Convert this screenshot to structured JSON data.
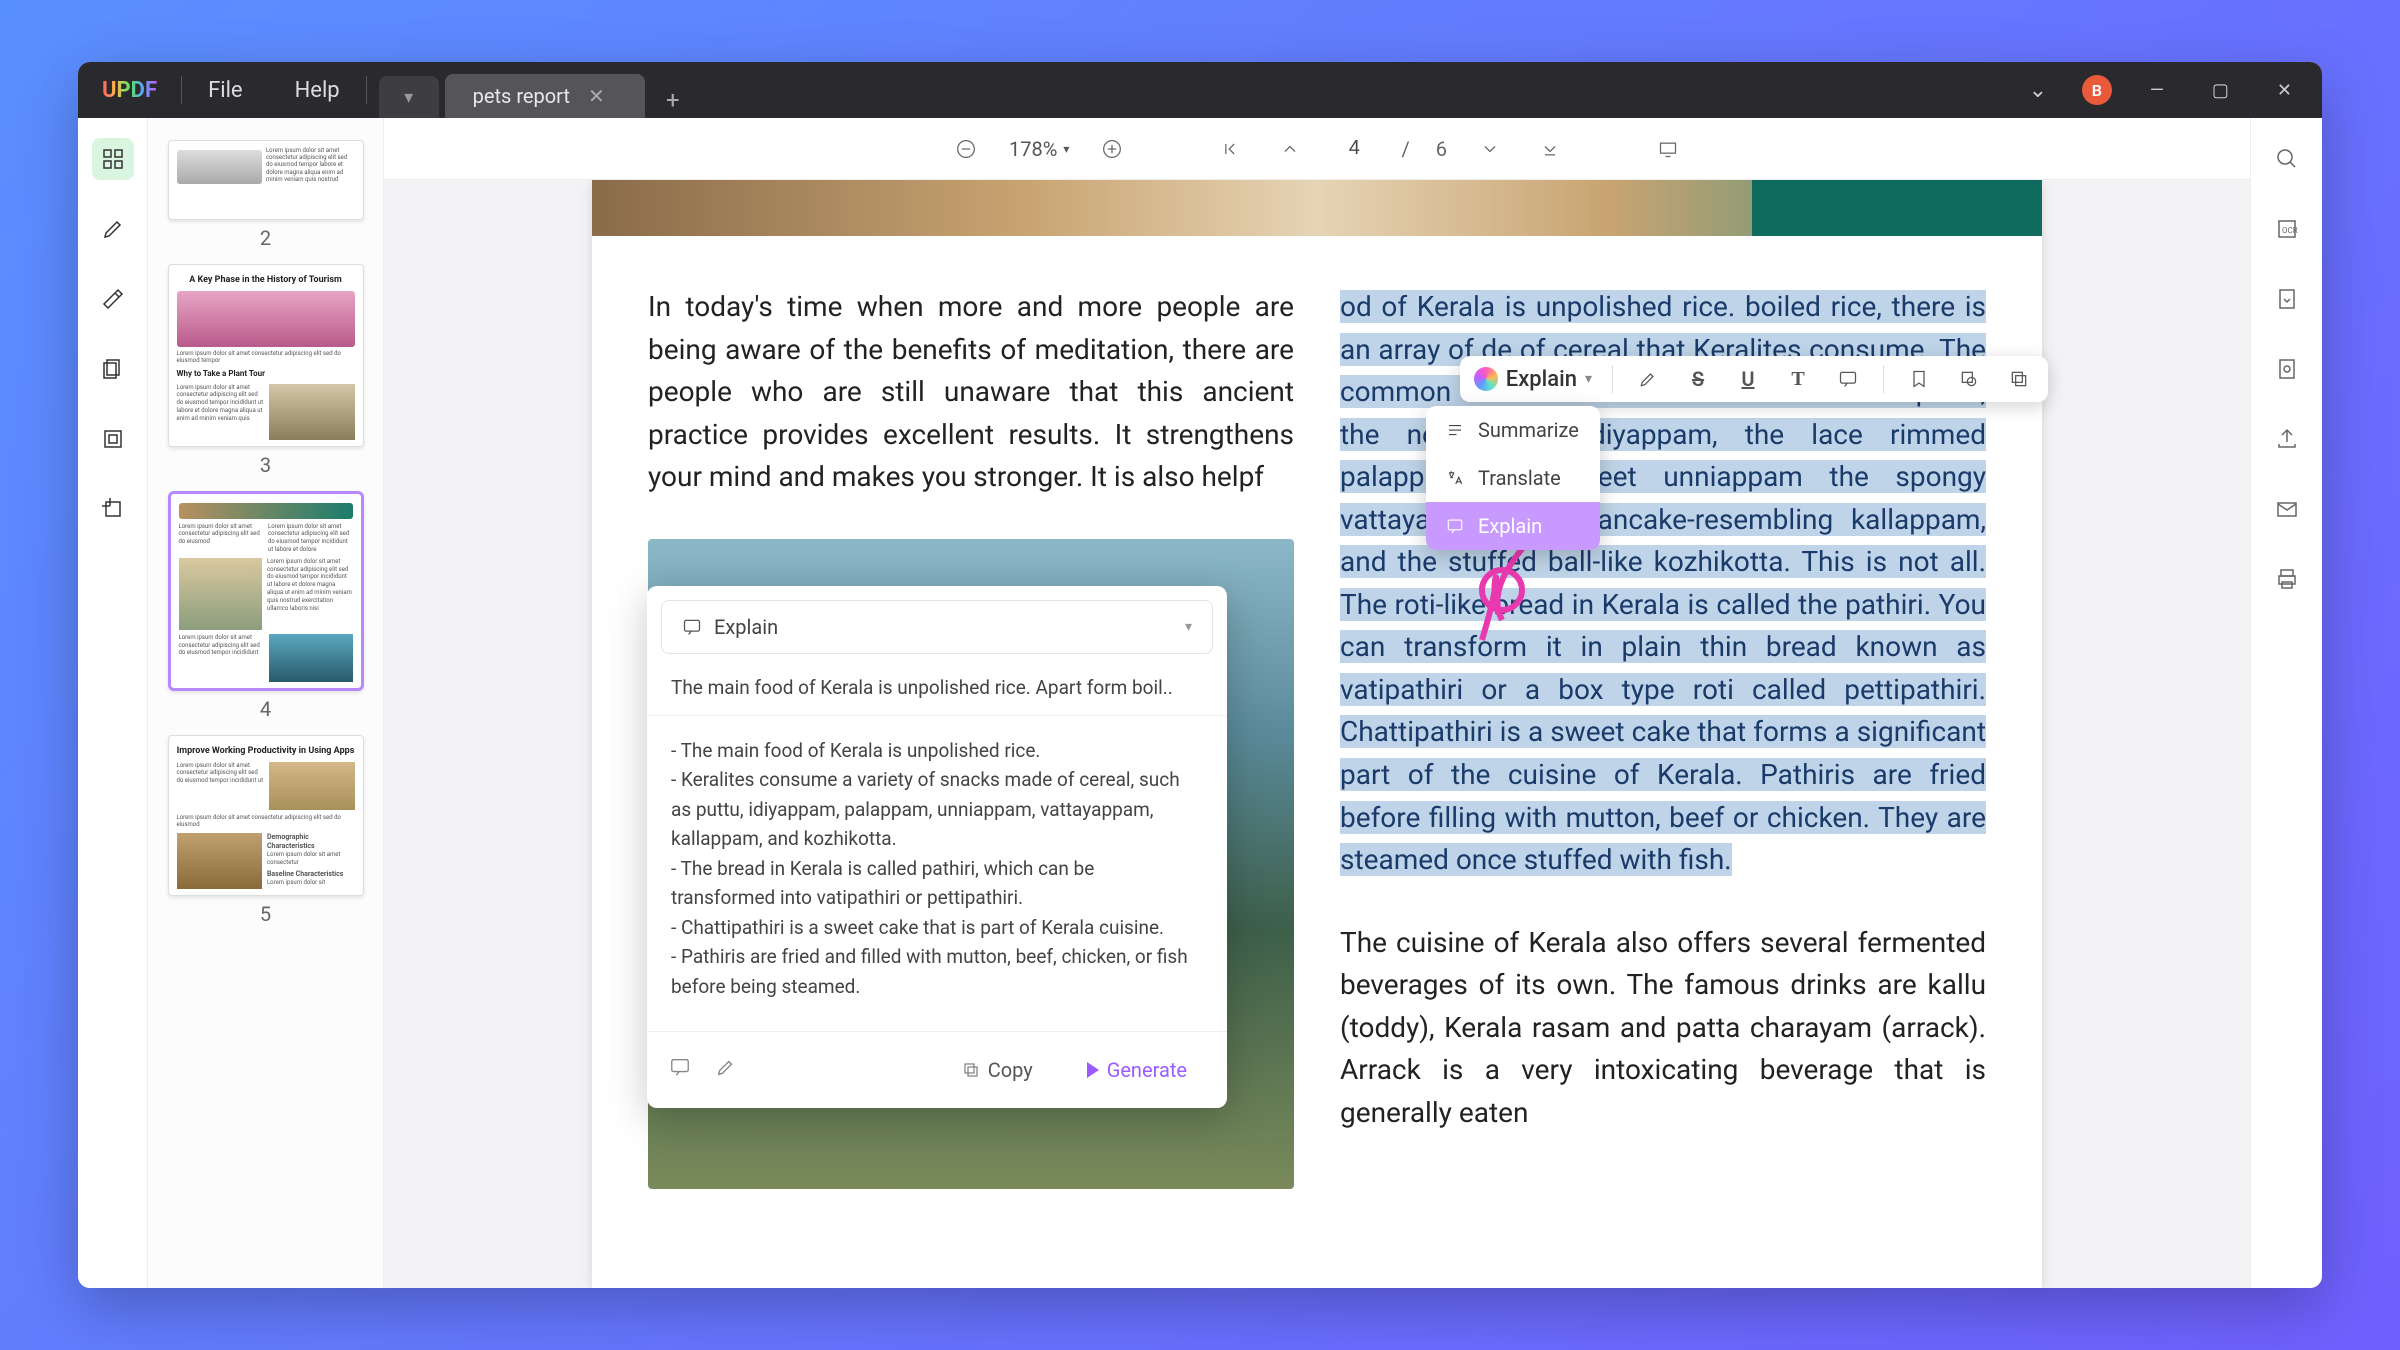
{
  "app": {
    "name": "UPDF",
    "avatar_initial": "B"
  },
  "menu": {
    "file": "File",
    "help": "Help"
  },
  "tab": {
    "title": "pets report"
  },
  "toolbar": {
    "zoom": "178%",
    "page_current": "4",
    "page_sep": "/",
    "page_total": "6"
  },
  "thumbs": {
    "n2": "2",
    "n3": "3",
    "n4": "4",
    "n5": "5",
    "p3_title": "A Key Phase in the History of Tourism",
    "p3_sub": "Why to Take a Plant Tour",
    "p5_title1": "Improve Working Productivity in Using Apps",
    "p5_title2": "Demographic Characteristics",
    "p5_title3": "Baseline Characteristics"
  },
  "doc": {
    "left_para": "In today's time when more and more people are being aware of the benefits of meditation, there are people who are still unaware that this ancient practice provides excellent results. It strengthens your mind and makes you stronger. It is also helpf",
    "right_high": "od of Kerala is unpolished rice. boiled rice, there is an array of de of cereal that Keralites consume. The common ones include the bamboo formed puttu, the noodles-like idiyappam, the lace rimmed palappam, the sweet unniappam the spongy vattayappam, the pancake-resembling kallappam, and the stuffed ball-like kozhikotta. This is not all. The roti-like bread in Kerala is called the pathiri. You can transform it in plain thin bread known as vatipathiri or a box type roti called pettipathiri. Chattipathiri is a sweet cake that forms a significant part of the cuisine of Kerala. Pathiris are fried before filling with mutton, beef or chicken. They are steamed once stuffed with fish.",
    "right_rest": "The cuisine of Kerala also offers several fermented beverages of its own. The famous drinks are kallu (toddy), Kerala rasam and patta charayam (arrack). Arrack is a very intoxicating beverage that is generally eaten"
  },
  "sel": {
    "ai_label": "Explain",
    "summarize": "Summarize",
    "translate": "Translate",
    "explain": "Explain"
  },
  "popup": {
    "head": "Explain",
    "src": "The main food of Kerala is unpolished rice. Apart form boil..",
    "result": "- The main food of Kerala is unpolished rice.\n- Keralites consume a variety of snacks made of cereal, such as puttu, idiyappam, palappam, unniappam, vattayappam, kallappam, and kozhikotta.\n- The bread in Kerala is called pathiri, which can be transformed into vatipathiri or pettipathiri.\n- Chattipathiri is a sweet cake that is part of Kerala cuisine.\n- Pathiris are fried and filled with mutton, beef, chicken, or fish before being steamed.",
    "copy": "Copy",
    "generate": "Generate"
  }
}
